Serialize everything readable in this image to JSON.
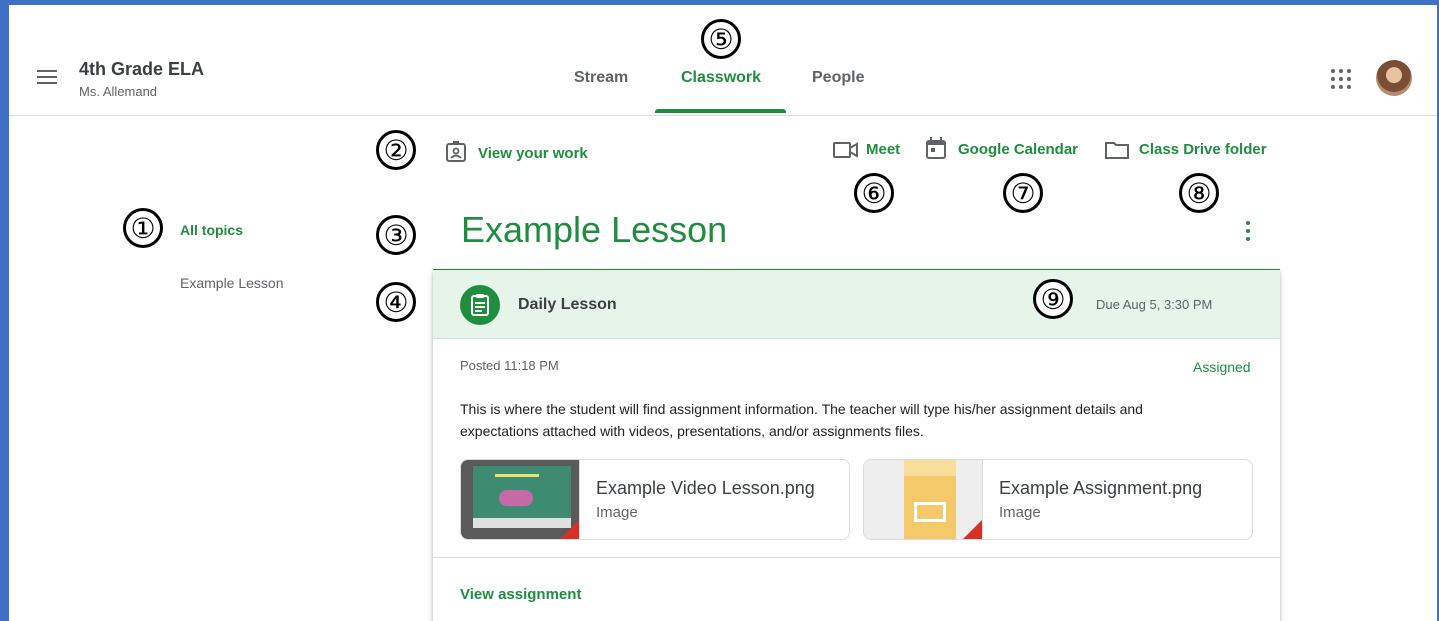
{
  "header": {
    "class_name": "4th Grade ELA",
    "teacher": "Ms. Allemand",
    "tabs": [
      {
        "label": "Stream"
      },
      {
        "label": "Classwork",
        "active": true
      },
      {
        "label": "People"
      }
    ]
  },
  "links": {
    "view_work": "View your work",
    "meet": "Meet",
    "calendar": "Google Calendar",
    "drive": "Class Drive folder"
  },
  "sidebar": {
    "all_topics": "All topics",
    "items": [
      {
        "label": "Example Lesson"
      }
    ]
  },
  "topic": {
    "title": "Example Lesson"
  },
  "assignment": {
    "title": "Daily Lesson",
    "due": "Due Aug 5, 3:30 PM",
    "posted": "Posted 11:18 PM",
    "status": "Assigned",
    "description": "This is where the student will find assignment information. The teacher will type his/her assignment details and expectations attached with videos, presentations, and/or assignments files.",
    "attachments": [
      {
        "name": "Example Video Lesson.png",
        "type": "Image"
      },
      {
        "name": "Example Assignment.png",
        "type": "Image"
      }
    ],
    "view_label": "View assignment"
  },
  "callouts": [
    "①",
    "②",
    "③",
    "④",
    "⑤",
    "⑥",
    "⑦",
    "⑧",
    "⑨"
  ],
  "colors": {
    "accent": "#1e8e3e",
    "accent_light": "#e6f4ea",
    "frame_border": "#3f72c7"
  }
}
